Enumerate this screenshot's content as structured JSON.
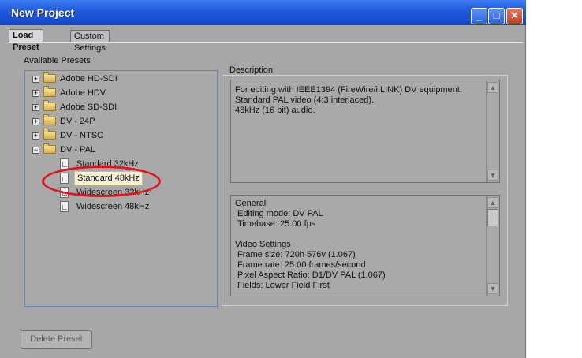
{
  "window": {
    "title": "New Project"
  },
  "title_buttons": {
    "minimize": "_",
    "maximize": "□",
    "close": "✕"
  },
  "tabs": [
    {
      "label": "Load Preset"
    },
    {
      "label": "Custom Settings"
    }
  ],
  "presets": {
    "label": "Available Presets",
    "folders": [
      {
        "label": "Adobe HD-SDI",
        "expander": "+"
      },
      {
        "label": "Adobe HDV",
        "expander": "+"
      },
      {
        "label": "Adobe SD-SDI",
        "expander": "+"
      },
      {
        "label": "DV - 24P",
        "expander": "+"
      },
      {
        "label": "DV - NTSC",
        "expander": "+"
      },
      {
        "label": "DV - PAL",
        "expander": "−"
      }
    ],
    "children": [
      {
        "label": "Standard 32kHz"
      },
      {
        "label": "Standard 48kHz"
      },
      {
        "label": "Widescreen 32kHz"
      },
      {
        "label": "Widescreen 48kHz"
      }
    ]
  },
  "description": {
    "label": "Description",
    "lines": [
      "For editing with IEEE1394 (FireWire/i.LINK) DV equipment.",
      "Standard PAL video (4:3 interlaced).",
      "48kHz (16 bit) audio."
    ]
  },
  "details": {
    "lines": [
      "General",
      " Editing mode: DV PAL",
      " Timebase: 25.00 fps",
      "",
      "Video Settings",
      " Frame size: 720h 576v (1.067)",
      " Frame rate: 25.00 frames/second",
      " Pixel Aspect Ratio: D1/DV PAL (1.067)",
      " Fields: Lower Field First"
    ]
  },
  "scroll_arrows": {
    "up": "▲",
    "down": "▼"
  },
  "buttons": {
    "delete_preset": "Delete Preset"
  }
}
